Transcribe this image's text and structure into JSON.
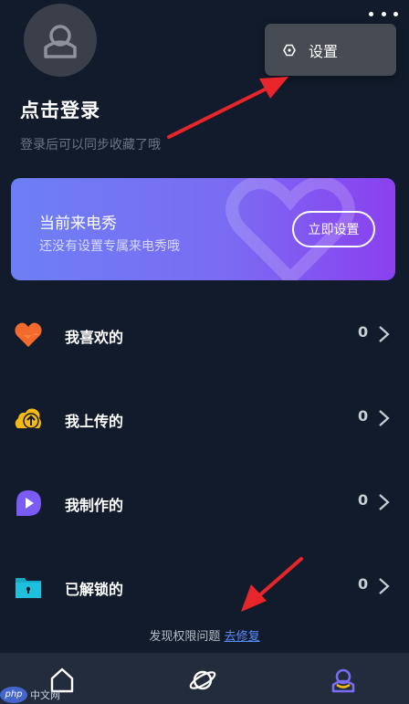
{
  "header": {
    "login_title": "点击登录",
    "login_subtitle": "登录后可以同步收藏了哦"
  },
  "settings_menu": {
    "label": "设置"
  },
  "banner": {
    "title": "当前来电秀",
    "subtitle": "还没有设置专属来电秀哦",
    "button_label": "立即设置"
  },
  "list": {
    "items": [
      {
        "label": "我喜欢的",
        "count": "0",
        "icon": "heart-icon",
        "color": "#f26a2e"
      },
      {
        "label": "我上传的",
        "count": "0",
        "icon": "upload-cloud-icon",
        "color": "#f5b914"
      },
      {
        "label": "我制作的",
        "count": "0",
        "icon": "play-icon",
        "color": "#7a5cf5"
      },
      {
        "label": "已解锁的",
        "count": "0",
        "icon": "unlock-folder-icon",
        "color": "#17a9c6"
      }
    ]
  },
  "footer": {
    "notice": "发现权限问题",
    "fix_link": "去修复"
  },
  "watermark": {
    "badge": "php",
    "text": "中文网"
  },
  "colors": {
    "background": "#111b2b",
    "banner_start": "#6d7ff4",
    "banner_end": "#8a40ef",
    "link": "#5b8dff",
    "tabbar": "#232c3c",
    "active_tab": "#7a6cf5",
    "annotation_arrow": "#e8252b"
  }
}
